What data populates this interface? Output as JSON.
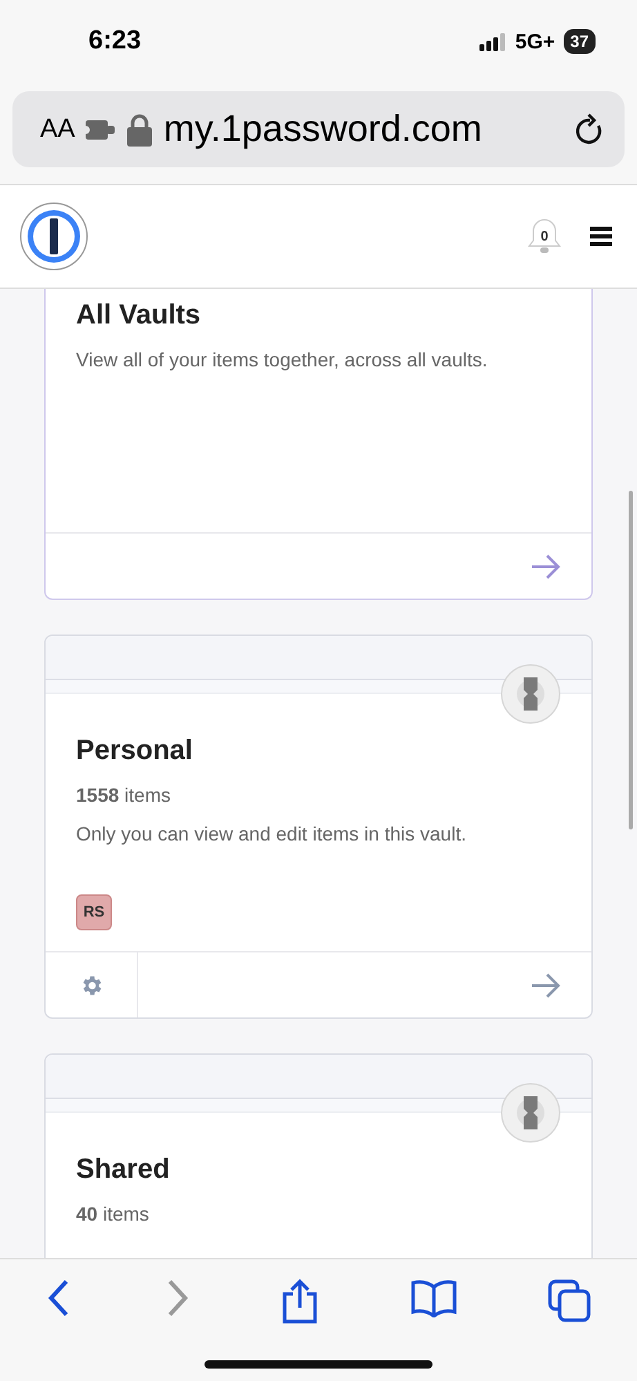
{
  "status_bar": {
    "time": "6:23",
    "network": "5G+",
    "battery": "37"
  },
  "browser": {
    "text_size": "AA",
    "url": "my.1password.com"
  },
  "header": {
    "notification_count": "0"
  },
  "vaults": [
    {
      "kind": "all",
      "title": "All Vaults",
      "description": "View all of your items together, across all vaults."
    },
    {
      "kind": "vault",
      "title": "Personal",
      "count": "**1558** items",
      "description": "Only you can view and edit items in this vault.",
      "members": [
        {
          "initials": "RS",
          "color": "#e0a9aa"
        }
      ]
    },
    {
      "kind": "vault",
      "title": "Shared",
      "count": "**40** items"
    }
  ]
}
